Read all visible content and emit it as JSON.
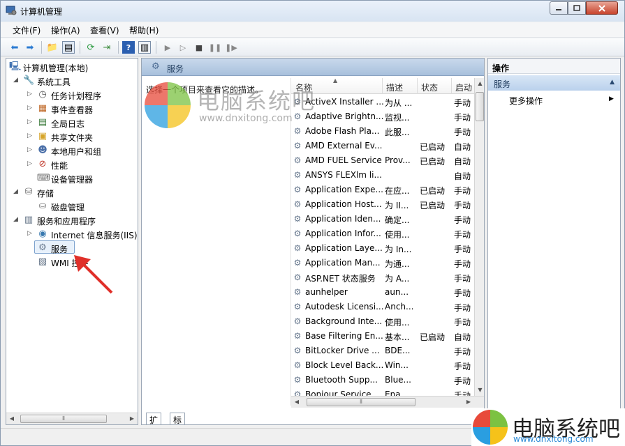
{
  "window": {
    "title": "计算机管理"
  },
  "menu": [
    "文件(F)",
    "操作(A)",
    "查看(V)",
    "帮助(H)"
  ],
  "tree": [
    {
      "label": "计算机管理(本地)",
      "icon": "computer-mgmt-icon",
      "level": 0,
      "expand": ""
    },
    {
      "label": "系统工具",
      "icon": "tools-icon",
      "level": 1,
      "expand": "expanded"
    },
    {
      "label": "任务计划程序",
      "icon": "clock-icon",
      "level": 2,
      "expand": "collapsed"
    },
    {
      "label": "事件查看器",
      "icon": "event-viewer-icon",
      "level": 2,
      "expand": "collapsed"
    },
    {
      "label": "全局日志",
      "icon": "log-icon",
      "level": 2,
      "expand": "collapsed"
    },
    {
      "label": "共享文件夹",
      "icon": "shared-folder-icon",
      "level": 2,
      "expand": "collapsed"
    },
    {
      "label": "本地用户和组",
      "icon": "users-icon",
      "level": 2,
      "expand": "collapsed"
    },
    {
      "label": "性能",
      "icon": "performance-icon",
      "level": 2,
      "expand": "collapsed"
    },
    {
      "label": "设备管理器",
      "icon": "device-manager-icon",
      "level": 2,
      "expand": ""
    },
    {
      "label": "存储",
      "icon": "storage-icon",
      "level": 1,
      "expand": "expanded"
    },
    {
      "label": "磁盘管理",
      "icon": "disk-icon",
      "level": 2,
      "expand": ""
    },
    {
      "label": "服务和应用程序",
      "icon": "services-apps-icon",
      "level": 1,
      "expand": "expanded"
    },
    {
      "label": "Internet 信息服务(IIS)管",
      "icon": "iis-icon",
      "level": 2,
      "expand": "collapsed"
    },
    {
      "label": "服务",
      "icon": "services-icon",
      "level": 2,
      "expand": ""
    },
    {
      "label": "WMI 控件",
      "icon": "wmi-icon",
      "level": 2,
      "expand": ""
    }
  ],
  "center": {
    "header": "服务",
    "description": "选择一个项目来查看它的描述。",
    "columns": [
      "名称",
      "描述",
      "状态",
      "启动"
    ],
    "rows": [
      {
        "name": "ActiveX Installer ...",
        "desc": "为从 ...",
        "status": "",
        "start": "手动"
      },
      {
        "name": "Adaptive Brightn...",
        "desc": "监视...",
        "status": "",
        "start": "手动"
      },
      {
        "name": "Adobe Flash Pla...",
        "desc": "此服...",
        "status": "",
        "start": "手动"
      },
      {
        "name": "AMD External Ev...",
        "desc": "",
        "status": "已启动",
        "start": "自动"
      },
      {
        "name": "AMD FUEL Service",
        "desc": "Prov...",
        "status": "已启动",
        "start": "自动"
      },
      {
        "name": "ANSYS FLEXlm li...",
        "desc": "",
        "status": "",
        "start": "自动"
      },
      {
        "name": "Application Expe...",
        "desc": "在应...",
        "status": "已启动",
        "start": "手动"
      },
      {
        "name": "Application Host...",
        "desc": "为 II...",
        "status": "已启动",
        "start": "手动"
      },
      {
        "name": "Application Iden...",
        "desc": "确定...",
        "status": "",
        "start": "手动"
      },
      {
        "name": "Application Infor...",
        "desc": "使用...",
        "status": "",
        "start": "手动"
      },
      {
        "name": "Application Laye...",
        "desc": "为 In...",
        "status": "",
        "start": "手动"
      },
      {
        "name": "Application Man...",
        "desc": "为通...",
        "status": "",
        "start": "手动"
      },
      {
        "name": "ASP.NET 状态服务",
        "desc": "为 A...",
        "status": "",
        "start": "手动"
      },
      {
        "name": "aunhelper",
        "desc": "aun...",
        "status": "",
        "start": "手动"
      },
      {
        "name": "Autodesk Licensi...",
        "desc": "Anch...",
        "status": "",
        "start": "手动"
      },
      {
        "name": "Background Inte...",
        "desc": "使用...",
        "status": "",
        "start": "手动"
      },
      {
        "name": "Base Filtering En...",
        "desc": "基本...",
        "status": "已启动",
        "start": "自动"
      },
      {
        "name": "BitLocker Drive ...",
        "desc": "BDE...",
        "status": "",
        "start": "手动"
      },
      {
        "name": "Block Level Back...",
        "desc": "Win...",
        "status": "",
        "start": "手动"
      },
      {
        "name": "Bluetooth Supp...",
        "desc": "Blue...",
        "status": "",
        "start": "手动"
      },
      {
        "name": "Bonjour Service",
        "desc": "Ena...",
        "status": "",
        "start": "手动"
      }
    ],
    "tabs": [
      "扩展",
      "标准"
    ]
  },
  "actions": {
    "title": "操作",
    "section": "服务",
    "more": "更多操作"
  },
  "watermark": {
    "center_text": "电脑系统吧",
    "center_url": "www.dnxitong.com",
    "corner_text": "电脑系统吧",
    "corner_url": "www.dnxitong.com"
  },
  "colors": {
    "header_blue": "#a8c0dc",
    "annotation_red": "#e0302a",
    "logo_red": "#e84a3a",
    "logo_green": "#7cc242",
    "logo_blue": "#2a9ee0",
    "logo_yellow": "#f5c21a"
  }
}
